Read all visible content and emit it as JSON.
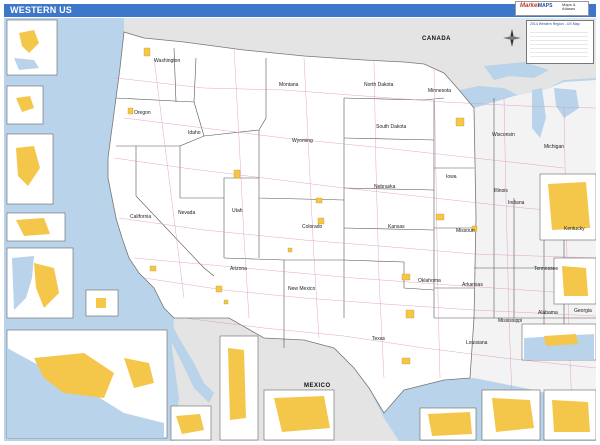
{
  "header": {
    "title": "WESTERN US"
  },
  "logo": {
    "brand_a": "Market",
    "brand_b": "MAPS",
    "sub": "Maps & Atlases"
  },
  "labels": {
    "canada": "CANADA",
    "mexico": "MEXICO",
    "washington": "Washington",
    "oregon": "Oregon",
    "idaho": "Idaho",
    "montana": "Montana",
    "wyoming": "Wyoming",
    "nevada": "Nevada",
    "utah": "Utah",
    "california": "California",
    "arizona": "Arizona",
    "new_mexico": "New Mexico",
    "colorado": "Colorado",
    "north_dakota": "North Dakota",
    "south_dakota": "South Dakota",
    "nebraska": "Nebraska",
    "kansas": "Kansas",
    "oklahoma": "Oklahoma",
    "texas": "Texas",
    "minnesota": "Minnesota",
    "iowa": "Iowa",
    "missouri": "Missouri",
    "arkansas": "Arkansas",
    "louisiana": "Louisiana",
    "wisconsin": "Wisconsin",
    "michigan": "Michigan",
    "illinois": "Illinois",
    "indiana": "Indiana",
    "kentucky": "Kentucky",
    "tennessee": "Tennessee",
    "mississippi": "Mississippi",
    "alabama": "Alabama",
    "georgia": "Georgia"
  },
  "legend": {
    "title": "2014 Western Region - US Map"
  },
  "colors": {
    "header": "#3d77c9",
    "water": "#b9d3ea",
    "land": "#ffffff",
    "foreign": "#e4e4e4",
    "east": "#f3f3f3",
    "urban": "#f4c64a",
    "roads": "#d98fc2",
    "border": "#555555"
  }
}
